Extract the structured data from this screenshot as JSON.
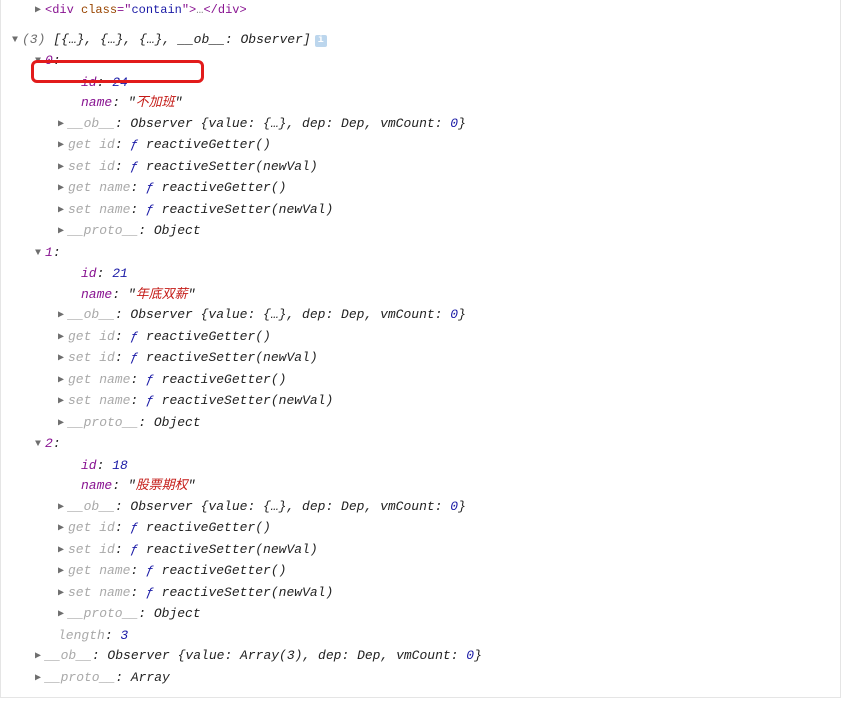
{
  "topLine": {
    "open": "<div ",
    "attrName": "class",
    "eq": "=\"",
    "attrVal": "contain",
    "close": "\">",
    "ellipsis": "…",
    "closeTag": "</div>"
  },
  "header": {
    "prefix": "(3) ",
    "summary": "[{…}, {…}, {…}, ",
    "obKey": "__ob__",
    "obSep": ": ",
    "obVal": "Observer",
    "close": "]",
    "info": "i"
  },
  "items": [
    {
      "index": "0",
      "id": "24",
      "name": "不加班"
    },
    {
      "index": "1",
      "id": "21",
      "name": "年底双薪"
    },
    {
      "index": "2",
      "id": "18",
      "name": "股票期权"
    }
  ],
  "labels": {
    "id": "id",
    "name": "name",
    "ob": "__ob__",
    "obSummary": "Observer {value: {…}, dep: Dep, vmCount: ",
    "obVmCount": "0",
    "obClose": "}",
    "getId": "get id",
    "setId": "set id",
    "getName": "get name",
    "setName": "set name",
    "reactiveGetter": "reactiveGetter()",
    "reactiveSetter": "reactiveSetter(newVal)",
    "proto": "__proto__",
    "object": "Object",
    "fSym": "ƒ "
  },
  "footer": {
    "lengthLabel": "length",
    "lengthVal": "3",
    "ob": "__ob__",
    "obSummary": "Observer {value: Array(3), dep: Dep, vmCount: ",
    "obVmCount": "0",
    "obClose": "}",
    "proto": "__proto__",
    "array": "Array"
  },
  "sep": ": "
}
